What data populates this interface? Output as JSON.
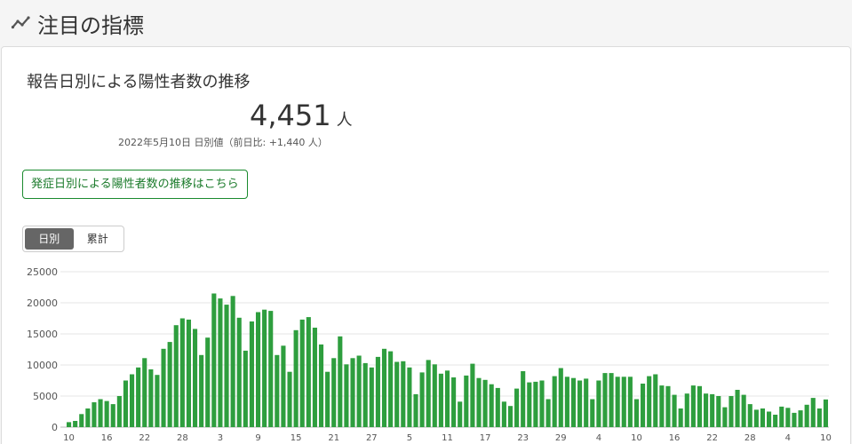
{
  "section": {
    "title": "注目の指標",
    "icon": "trend-line-icon"
  },
  "card": {
    "title": "報告日別による陽性者数の推移",
    "big_value": "4,451",
    "big_unit": "人",
    "subinfo": "2022年5月10日 日別値（前日比: +1,440 人）",
    "link_label": "発症日別による陽性者数の推移はこちら"
  },
  "toggle": {
    "daily_label": "日別",
    "cumulative_label": "累計",
    "active": "daily"
  },
  "colors": {
    "bar": "#2e9e3e",
    "accent": "#1a8a2e"
  },
  "chart_data": {
    "type": "bar",
    "ylim": [
      0,
      25000
    ],
    "yticks": [
      0,
      5000,
      10000,
      15000,
      20000,
      25000
    ],
    "grid": true,
    "x_tick_labels": [
      "10",
      "16",
      "22",
      "28",
      "3",
      "9",
      "15",
      "21",
      "27",
      "5",
      "11",
      "17",
      "23",
      "29",
      "4",
      "10",
      "16",
      "22",
      "28",
      "4",
      "10"
    ],
    "x_tick_step": 6,
    "series": [
      {
        "values": [
          800,
          1000,
          2100,
          3000,
          4000,
          4500,
          4200,
          3700,
          5000,
          7500,
          8500,
          9600,
          11100,
          9300,
          8400,
          12600,
          13700,
          16400,
          17500,
          17300,
          15800,
          11600,
          14400,
          21500,
          20700,
          19700,
          21100,
          17600,
          12300,
          17000,
          18500,
          18900,
          18700,
          11600,
          13100,
          8900,
          15600,
          17300,
          17700,
          16000,
          13300,
          8900,
          11100,
          14600,
          10100,
          11100,
          11500,
          10300,
          9600,
          11300,
          12600,
          12200,
          10500,
          10600,
          9600,
          5300,
          8800,
          10800,
          10100,
          8600,
          9100,
          8000,
          4100,
          8300,
          10200,
          7900,
          7600,
          6900,
          6300,
          4100,
          3400,
          6200,
          9000,
          7200,
          7300,
          7500,
          4500,
          8200,
          9500,
          8100,
          7900,
          7500,
          7800,
          4500,
          7500,
          8700,
          8700,
          8100,
          8100,
          8100,
          4500,
          7000,
          8200,
          8500,
          6700,
          6600,
          5200,
          3000,
          5400,
          6700,
          6600,
          5400,
          5300,
          5000,
          3200,
          5000,
          6000,
          5200,
          3700,
          2800,
          3000,
          2500,
          2000,
          3300,
          3100,
          2300,
          2700,
          3600,
          4700,
          3000,
          4451
        ]
      }
    ]
  }
}
